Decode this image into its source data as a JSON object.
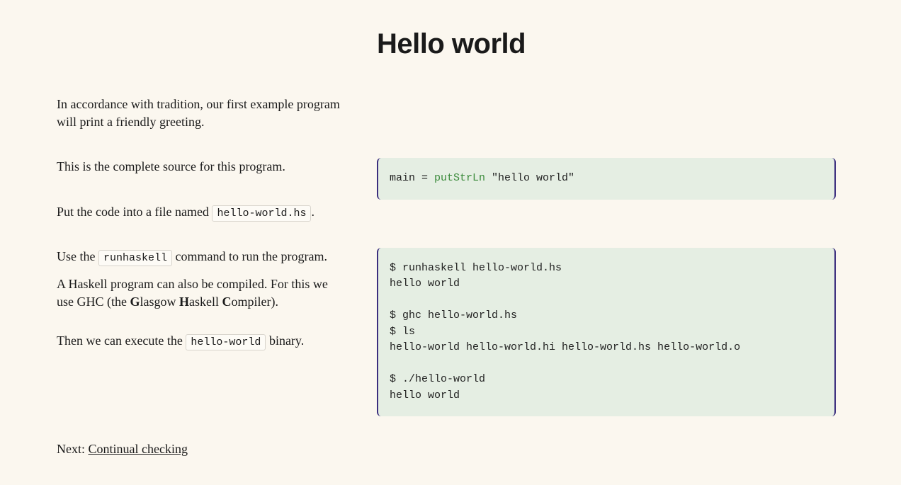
{
  "title": "Hello world",
  "intro": "In accordance with tradition, our first example program will print a friendly greeting.",
  "source_desc": "This is the complete source for this program.",
  "source_code": {
    "pre": "main = ",
    "fn": "putStrLn",
    "post": " \"hello world\""
  },
  "file_instr": {
    "pre": "Put the code into a file named ",
    "code": "hello-world.hs",
    "post": "."
  },
  "run_instr": {
    "pre": "Use the ",
    "code": "runhaskell",
    "post": " command to run the program."
  },
  "compile_instr": {
    "pre": "A Haskell program can also be compiled. For this we use GHC (the ",
    "b1": "G",
    "t1": "lasgow ",
    "b2": "H",
    "t2": "askell ",
    "b3": "C",
    "t3": "ompiler)."
  },
  "exec_instr": {
    "pre": "Then we can execute the ",
    "code": "hello-world",
    "post": " binary."
  },
  "terminal": "$ runhaskell hello-world.hs\nhello world\n\n$ ghc hello-world.hs\n$ ls\nhello-world hello-world.hi hello-world.hs hello-world.o\n\n$ ./hello-world\nhello world",
  "next_label": "Next: ",
  "next_link": "Continual checking"
}
